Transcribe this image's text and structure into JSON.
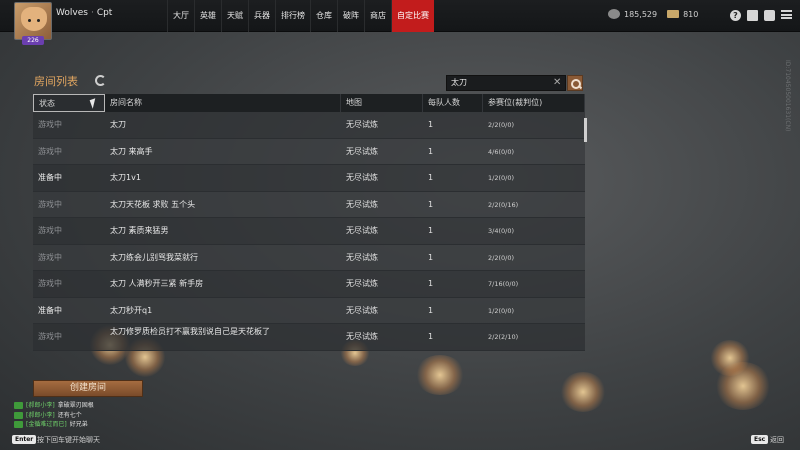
{
  "header": {
    "level": "226",
    "user": "Wolves",
    "user_sep": "·",
    "user_suffix": "Cpt",
    "nav": [
      "大厅",
      "英雄",
      "天赋",
      "兵器",
      "排行榜",
      "仓库",
      "破阵",
      "商店",
      "自定比赛"
    ],
    "active_nav": "自定比赛",
    "silver": "185,529",
    "gold": "810",
    "help_label": "?",
    "icons": [
      "help-icon",
      "mail-icon",
      "message-icon",
      "menu-icon"
    ]
  },
  "watermark": "ID:7104505001631(CN)",
  "room_list": {
    "title": "房间列表",
    "search_value": "太刀",
    "search_clear": "✕",
    "columns": [
      "状态",
      "房间名称",
      "地图",
      "每队人数",
      "参赛位(裁判位)"
    ],
    "rows": [
      {
        "status": "游戏中",
        "name": "太刀",
        "map": "无尽试炼",
        "per_team": "1",
        "slots": "2/2(0/0)"
      },
      {
        "status": "游戏中",
        "name": "太刀 来高手",
        "map": "无尽试炼",
        "per_team": "1",
        "slots": "4/6(0/0)"
      },
      {
        "status": "准备中",
        "name": "太刀1v1",
        "map": "无尽试炼",
        "per_team": "1",
        "slots": "1/2(0/0)"
      },
      {
        "status": "游戏中",
        "name": "太刀天花板 求败 五个头",
        "map": "无尽试炼",
        "per_team": "1",
        "slots": "2/2(0/16)"
      },
      {
        "status": "游戏中",
        "name": "太刀 素质来猛男",
        "map": "无尽试炼",
        "per_team": "1",
        "slots": "3/4(0/0)"
      },
      {
        "status": "游戏中",
        "name": "太刀练会儿别骂我菜就行",
        "map": "无尽试炼",
        "per_team": "1",
        "slots": "2/2(0/0)"
      },
      {
        "status": "游戏中",
        "name": "太刀 人满秒开三紧 新手房",
        "map": "无尽试炼",
        "per_team": "1",
        "slots": "7/16(0/0)"
      },
      {
        "status": "准备中",
        "name": "太刀秒开q1",
        "map": "无尽试炼",
        "per_team": "1",
        "slots": "1/2(0/0)"
      },
      {
        "status": "游戏中",
        "name": "太刀修罗质检员打不赢我别说自己是天花板了",
        "map": "无尽试炼",
        "per_team": "1",
        "slots": "2/2(2/10)"
      }
    ],
    "create_button": "创建房间"
  },
  "chat": [
    {
      "who": "[郝郎小李]",
      "msg": "拿破翠刃固根"
    },
    {
      "who": "[郝郎小李]",
      "msg": "还有七个"
    },
    {
      "who": "[金循难过而已]",
      "msg": "好兄弟"
    }
  ],
  "footer": {
    "enter_key": "Enter",
    "enter_hint": "按下回车键开始聊天",
    "esc_key": "Esc",
    "esc_hint": "返回"
  },
  "colors": {
    "accent": "#e0a560",
    "active_tab": "#c21c1c",
    "button": "#8a5a36",
    "chat_name": "#6fd06a"
  }
}
